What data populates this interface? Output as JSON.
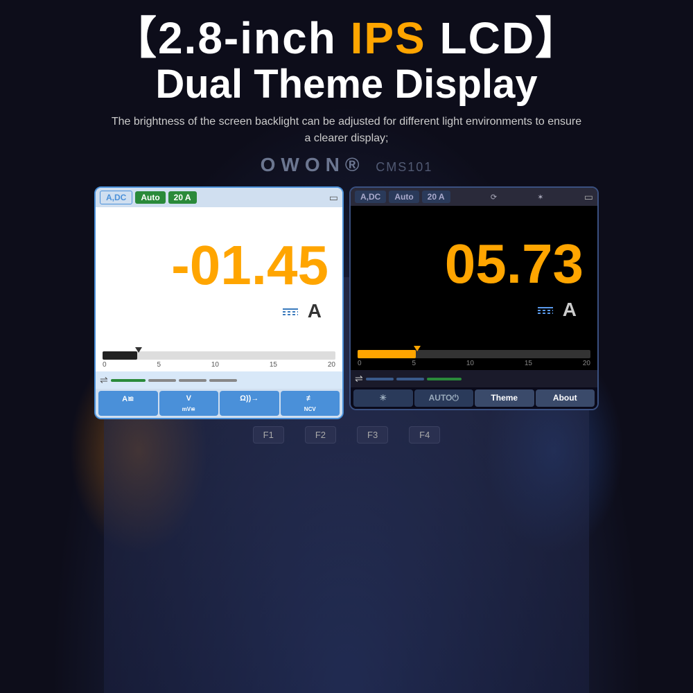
{
  "header": {
    "title_line1": "【2.8-inch IPS LCD】",
    "title_bracket_open": "【2.8-inch ",
    "title_ips": "IPS",
    "title_rest": " LCD】",
    "title_line2": "Dual Theme Display",
    "subtitle": "The brightness of the screen backlight can be adjusted for different light environments to ensure a clearer display;",
    "owon_brand": "OWON",
    "owon_model": "CMS101"
  },
  "light_screen": {
    "badge1": "A,DC",
    "badge2": "Auto",
    "badge3": "20 A",
    "main_value": "-01.45",
    "unit": "A",
    "scale_labels": [
      "0",
      "5",
      "10",
      "15",
      "20"
    ],
    "func1": "A≌",
    "func1_sub": "",
    "func2_top": "V",
    "func2_bot": "mV≌",
    "func3": "Ω))→",
    "func4": "NCV"
  },
  "dark_screen": {
    "badge1": "A,DC",
    "badge2": "Auto",
    "badge3": "20 A",
    "main_value": "05.73",
    "unit": "A",
    "scale_labels": [
      "0",
      "5",
      "10",
      "15",
      "20"
    ],
    "btn_brightness": "☀",
    "btn_auto": "AUTO",
    "btn_theme": "Theme",
    "btn_about": "About"
  },
  "bottom_fn": {
    "f1": "F1",
    "f2": "F2",
    "f3": "F3",
    "f4": "F4"
  },
  "colors": {
    "accent_orange": "#FFA500",
    "accent_blue": "#4a90d9",
    "accent_green": "#2a8a3a",
    "bg_dark": "#0d0d1a"
  }
}
